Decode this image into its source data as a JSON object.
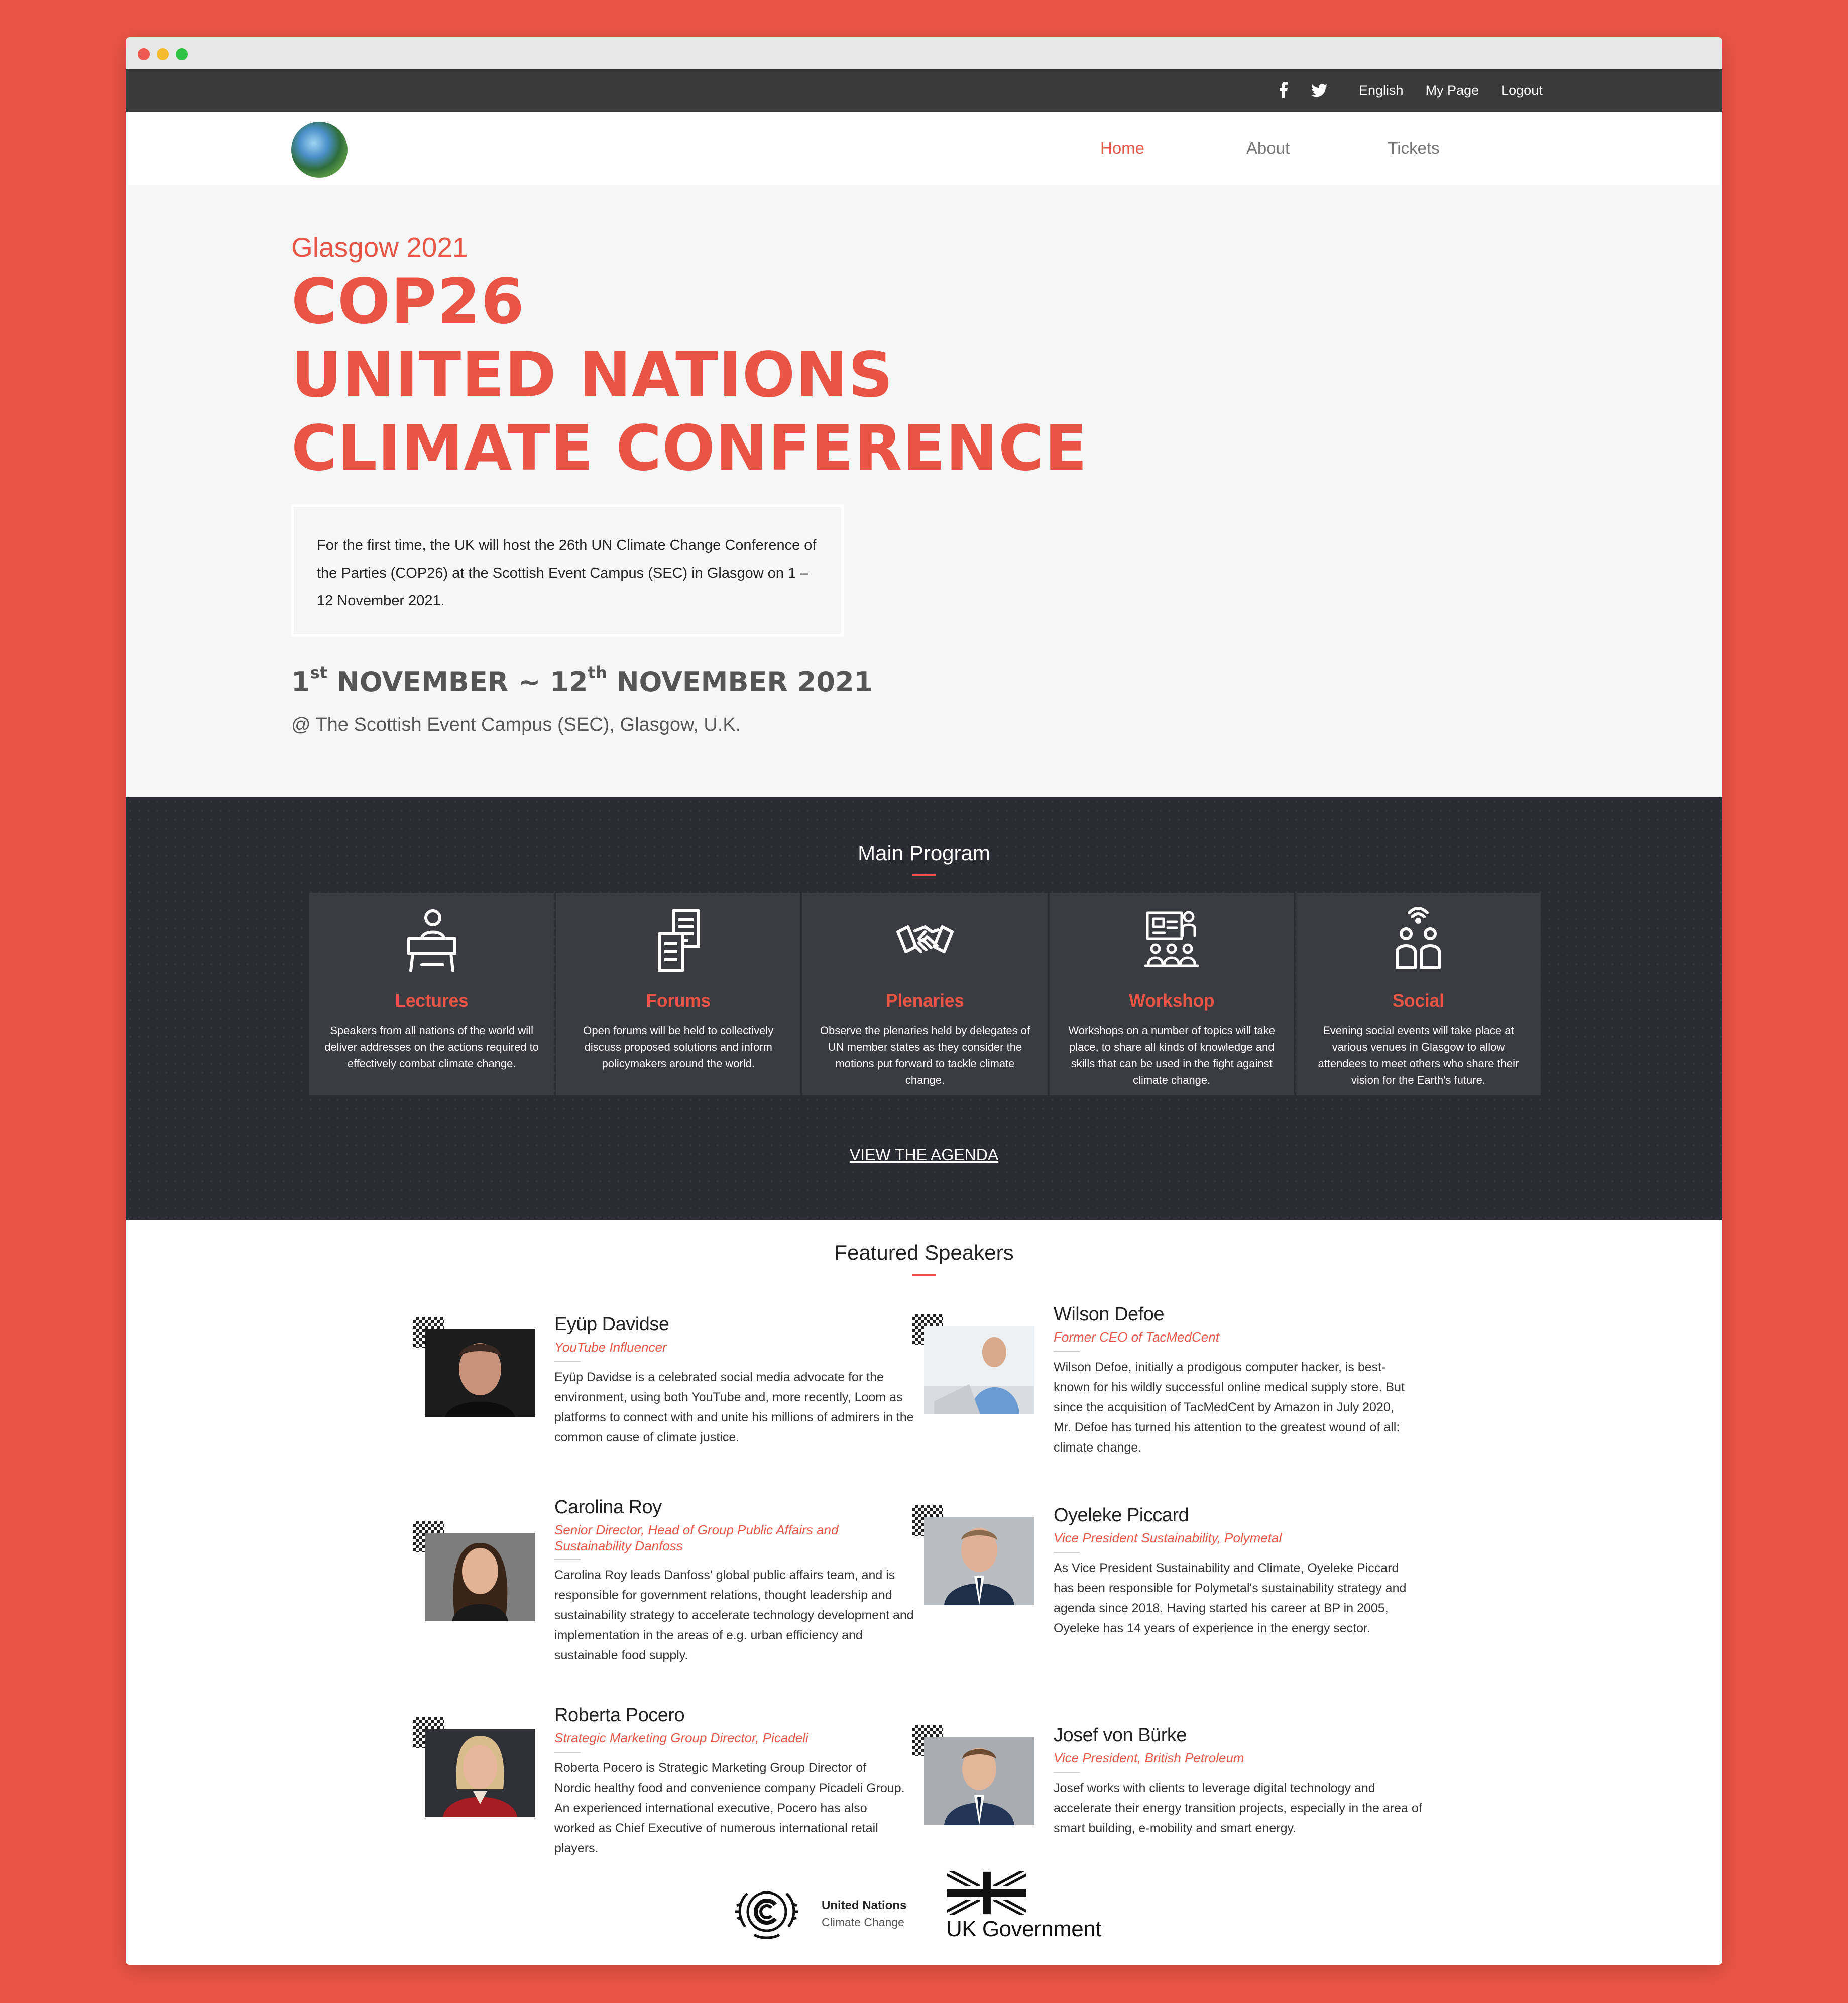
{
  "topbar": {
    "social_icons": [
      "facebook-icon",
      "twitter-icon"
    ],
    "links": [
      "English",
      "My Page",
      "Logout"
    ]
  },
  "nav": {
    "items": [
      "Home",
      "About",
      "Tickets"
    ],
    "active": "Home"
  },
  "hero": {
    "kicker": "Glasgow 2021",
    "title_lines": [
      "COP26",
      "UNITED NATIONS",
      "CLIMATE CONFERENCE"
    ],
    "intro": "For the first time, the UK will host the 26th UN Climate Change Conference of the Parties (COP26) at the Scottish Event Campus (SEC) in Glasgow on 1 – 12 November 2021.",
    "dates": {
      "start_day": "1",
      "start_suffix": "st",
      "start_month": "NOVEMBER ~ 12",
      "end_suffix": "th",
      "end_rest": "NOVEMBER 2021"
    },
    "venue": "@ The Scottish Event Campus (SEC), Glasgow, U.K."
  },
  "program": {
    "heading": "Main Program",
    "cards": [
      {
        "icon": "lecturer-icon",
        "title": "Lectures",
        "text": "Speakers from all nations of the world will deliver addresses on the actions required to effectively combat climate change."
      },
      {
        "icon": "documents-icon",
        "title": "Forums",
        "text": "Open forums will be held to collectively discuss proposed solutions and inform policymakers around the world."
      },
      {
        "icon": "handshake-icon",
        "title": "Plenaries",
        "text": "Observe the plenaries held by delegates of UN member states as they consider the motions put forward to tackle climate change."
      },
      {
        "icon": "workshop-icon",
        "title": "Workshop",
        "text": "Workshops on a number of topics will take place, to share all kinds of knowledge and skills that can be used in the fight against climate change."
      },
      {
        "icon": "people-icon",
        "title": "Social",
        "text": "Evening social events will take place at various venues in Glasgow to allow attendees to meet others who share their vision for the Earth's future."
      }
    ],
    "agenda_link": "VIEW THE AGENDA"
  },
  "speakers": {
    "heading": "Featured Speakers",
    "items": [
      {
        "name": "Eyüp Davidse",
        "role": "YouTube Influencer",
        "bio": "Eyüp Davidse is a celebrated social media advocate for the environment, using both YouTube and, more recently, Loom as platforms to connect with and unite his millions of admirers in the common cause of climate justice."
      },
      {
        "name": "Wilson Defoe",
        "role": "Former CEO of TacMedCent",
        "bio": "Wilson Defoe, initially a prodigous computer hacker, is best-known for his wildly successful online medical supply store. But since the acquisition of TacMedCent by Amazon in July 2020, Mr. Defoe has turned his attention to the greatest wound of all: climate change."
      },
      {
        "name": "Carolina Roy",
        "role": "Senior Director, Head of Group Public Affairs and Sustainability Danfoss",
        "bio": "Carolina Roy leads Danfoss' global public affairs team, and is responsible for government relations, thought leadership and sustainability strategy to accelerate technology development and implementation in the areas of e.g. urban efficiency and sustainable food supply."
      },
      {
        "name": "Oyeleke Piccard",
        "role": "Vice President Sustainability, Polymetal",
        "bio": "As Vice President Sustainability and Climate, Oyeleke Piccard has been responsible for Polymetal's sustainability strategy and agenda since 2018. Having started his career at BP in 2005, Oyeleke has 14 years of experience in the energy sector."
      },
      {
        "name": "Roberta Pocero",
        "role": "Strategic Marketing Group Director, Picadeli",
        "bio": "Roberta Pocero is Strategic Marketing Group Director of Nordic healthy food and convenience company Picadeli Group. An experienced international executive, Pocero has also worked as Chief Executive of numerous international retail players."
      },
      {
        "name": "Josef von Bürke",
        "role": "Vice President, British Petroleum",
        "bio": "Josef works with clients to leverage digital technology and accelerate their energy transition projects, especially in the area of smart building, e-mobility and smart energy."
      }
    ]
  },
  "partners": {
    "unfccc_line1": "United Nations",
    "unfccc_line2": "Climate Change",
    "ukgov": "UK Government"
  },
  "colors": {
    "accent": "#ea5445",
    "dark": "#2b2c33",
    "topbar": "#3a3a3a"
  }
}
